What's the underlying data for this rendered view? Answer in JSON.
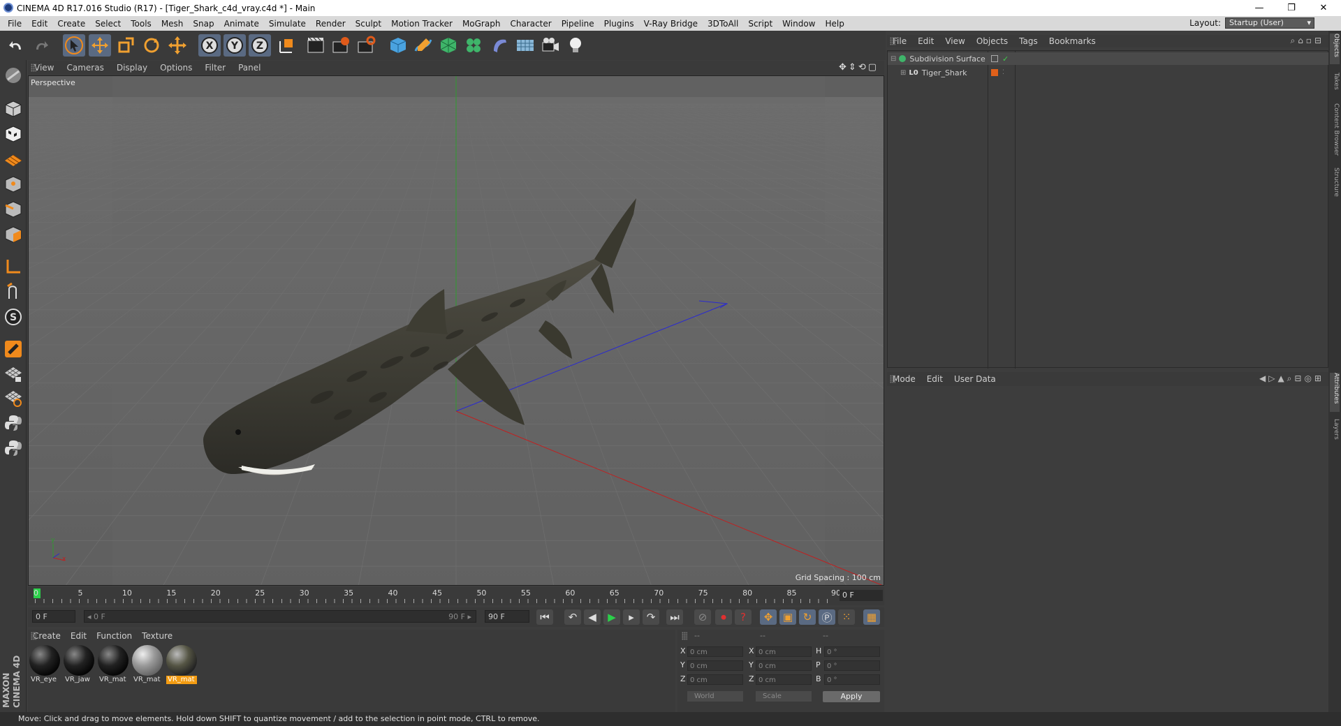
{
  "window": {
    "title": "CINEMA 4D R17.016 Studio (R17) - [Tiger_Shark_c4d_vray.c4d *] - Main",
    "minimize": "—",
    "maximize": "❐",
    "close": "✕"
  },
  "menubar": {
    "items": [
      "File",
      "Edit",
      "Create",
      "Select",
      "Tools",
      "Mesh",
      "Snap",
      "Animate",
      "Simulate",
      "Render",
      "Sculpt",
      "Motion Tracker",
      "MoGraph",
      "Character",
      "Pipeline",
      "Plugins",
      "V-Ray Bridge",
      "3DToAll",
      "Script",
      "Window",
      "Help"
    ],
    "layout_label": "Layout:",
    "layout_value": "Startup (User)"
  },
  "toolbar": {
    "icons": [
      "undo-icon",
      "redo-icon",
      "select-arrow-icon",
      "move-icon",
      "scale-icon",
      "rotate-icon",
      "live-select-icon",
      "x-axis-icon",
      "y-axis-icon",
      "z-axis-icon",
      "world-coord-icon",
      "render-view-icon",
      "render-picture-queue-icon",
      "render-settings-icon",
      "cube-icon",
      "pen-icon",
      "subdivision-icon",
      "cloner-icon",
      "deformer-icon",
      "floor-icon",
      "camera-icon",
      "light-icon"
    ]
  },
  "viewport": {
    "menu": [
      "View",
      "Cameras",
      "Display",
      "Options",
      "Filter",
      "Panel"
    ],
    "label": "Perspective",
    "grid_spacing": "Grid Spacing : 100 cm"
  },
  "timeline": {
    "ticks": [
      "0",
      "5",
      "10",
      "15",
      "20",
      "25",
      "30",
      "35",
      "40",
      "45",
      "50",
      "55",
      "60",
      "65",
      "70",
      "75",
      "80",
      "85",
      "90"
    ],
    "current_frame": "0 F",
    "start_field": "0 F",
    "range_start": "◂ 0 F",
    "range_end": "90 F ▸",
    "end_field": "90 F"
  },
  "materials": {
    "menu": [
      "Create",
      "Edit",
      "Function",
      "Texture"
    ],
    "items": [
      {
        "label": "VR_eye",
        "selected": false
      },
      {
        "label": "VR_jaw",
        "selected": false
      },
      {
        "label": "VR_mat",
        "selected": false
      },
      {
        "label": "VR_mat",
        "selected": false
      },
      {
        "label": "VR_mat",
        "selected": true
      }
    ]
  },
  "coords": {
    "headers": [
      "--",
      "--",
      "--"
    ],
    "rows": [
      {
        "l1": "X",
        "v1": "0 cm",
        "l2": "X",
        "v2": "0 cm",
        "l3": "H",
        "v3": "0 °"
      },
      {
        "l1": "Y",
        "v1": "0 cm",
        "l2": "Y",
        "v2": "0 cm",
        "l3": "P",
        "v3": "0 °"
      },
      {
        "l1": "Z",
        "v1": "0 cm",
        "l2": "Z",
        "v2": "0 cm",
        "l3": "B",
        "v3": "0 °"
      }
    ],
    "mode1": "World",
    "mode2": "Scale",
    "apply": "Apply"
  },
  "objects": {
    "menu": [
      "File",
      "Edit",
      "View",
      "Objects",
      "Tags",
      "Bookmarks"
    ],
    "items": [
      {
        "name": "Subdivision Surface"
      },
      {
        "name": "Tiger_Shark"
      }
    ]
  },
  "attributes": {
    "menu": [
      "Mode",
      "Edit",
      "User Data"
    ]
  },
  "right_tabs": [
    "Objects",
    "Takes",
    "Content Browser",
    "Structure",
    "Attributes",
    "Layers"
  ],
  "status": "Move: Click and drag to move elements. Hold down SHIFT to quantize movement / add to the selection in point mode, CTRL to remove.",
  "brand": "MAXON CINEMA 4D"
}
